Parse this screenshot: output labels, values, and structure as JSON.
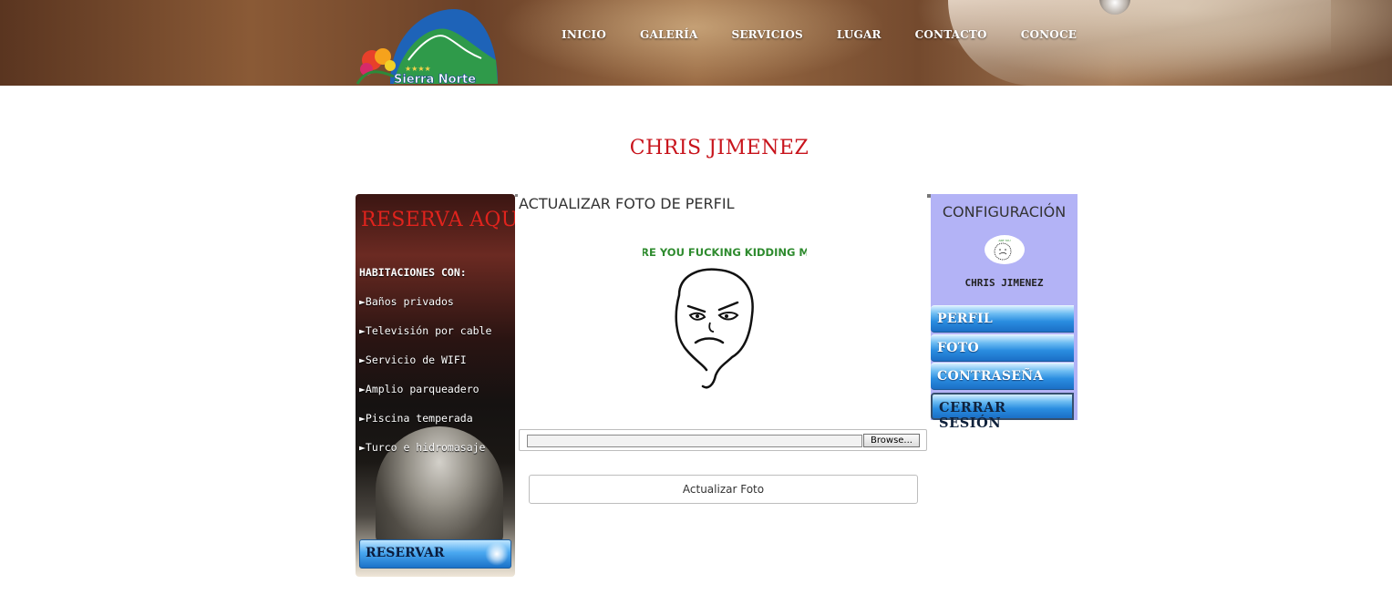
{
  "header": {
    "logo": {
      "text": "Sierra Norte",
      "stars": "★★★★"
    },
    "nav": [
      "INICIO",
      "GALERÍA",
      "SERVICIOS",
      "LUGAR",
      "CONTACTO",
      "CONOCE"
    ]
  },
  "page_title": "CHRIS JIMENEZ",
  "promo": {
    "title": "RESERVA AQUÍ",
    "heading": "HABITACIONES CON:",
    "items": [
      "►Baños privados",
      "►Televisión por cable",
      "►Servicio de WIFI",
      "►Amplio parqueadero",
      "►Piscina temperada",
      "►Turco e hidromasaje"
    ],
    "button_label": "RESERVAR"
  },
  "center": {
    "title": "ACTUALIZAR FOTO DE PERFIL",
    "meme_caption": "ARE YOU FUCKING KIDDING ME",
    "browse_label": "Browse...",
    "update_label": "Actualizar Foto"
  },
  "config": {
    "title": "CONFIGURACIÓN",
    "user_name": "CHRIS JIMENEZ",
    "menu": [
      "PERFIL",
      "FOTO",
      "CONTRASEÑA"
    ],
    "logout_label": "CERRAR SESIÓN"
  },
  "colors": {
    "title_red": "#c8141c",
    "config_bg": "#b3b3f6",
    "button_blue": "#2a8de0"
  }
}
